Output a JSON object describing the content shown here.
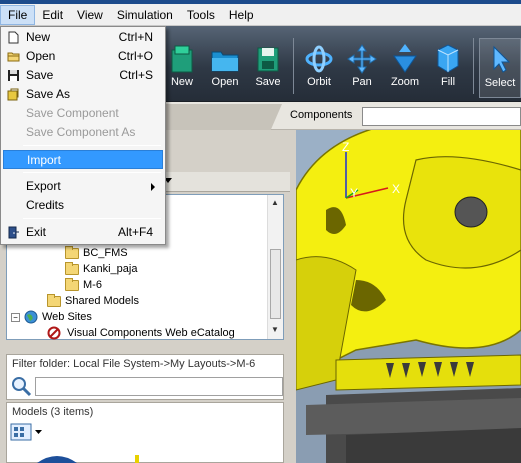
{
  "menubar": {
    "items": [
      "File",
      "Edit",
      "View",
      "Simulation",
      "Tools",
      "Help"
    ]
  },
  "toolbar": {
    "buttons": [
      {
        "label": "New",
        "icon": "new-layout-icon"
      },
      {
        "label": "Open",
        "icon": "open-folder-icon"
      },
      {
        "label": "Save",
        "icon": "save-disk-icon"
      },
      {
        "label": "Orbit",
        "icon": "orbit-icon"
      },
      {
        "label": "Pan",
        "icon": "pan-icon"
      },
      {
        "label": "Zoom",
        "icon": "zoom-icon"
      },
      {
        "label": "Fill",
        "icon": "fill-icon"
      },
      {
        "label": "Select",
        "icon": "select-cursor-icon"
      }
    ]
  },
  "components": {
    "label": "Components",
    "input_value": ""
  },
  "file_menu": {
    "items": [
      {
        "label": "New",
        "shortcut": "Ctrl+N",
        "icon": "new-file-icon",
        "enabled": true
      },
      {
        "label": "Open",
        "shortcut": "Ctrl+O",
        "icon": "open-folder-icon",
        "enabled": true
      },
      {
        "label": "Save",
        "shortcut": "Ctrl+S",
        "icon": "floppy-disk-icon",
        "enabled": true
      },
      {
        "label": "Save As",
        "shortcut": "",
        "icon": "save-as-icon",
        "enabled": true
      },
      {
        "label": "Save Component",
        "shortcut": "",
        "icon": "",
        "enabled": false
      },
      {
        "label": "Save Component As",
        "shortcut": "",
        "icon": "",
        "enabled": false
      },
      {
        "label": "Import",
        "shortcut": "",
        "icon": "",
        "enabled": true,
        "highlighted": true
      },
      {
        "label": "Export",
        "shortcut": "",
        "icon": "",
        "enabled": true,
        "submenu": true
      },
      {
        "label": "Credits",
        "shortcut": "",
        "icon": "",
        "enabled": true
      },
      {
        "label": "Exit",
        "shortcut": "Alt+F4",
        "icon": "exit-door-icon",
        "enabled": true
      }
    ]
  },
  "tree": {
    "items": [
      {
        "label": "BC_FMS",
        "type": "folder"
      },
      {
        "label": "Kanki_paja",
        "type": "folder"
      },
      {
        "label": "M-6",
        "type": "folder"
      },
      {
        "label": "Shared Models",
        "type": "folder"
      },
      {
        "label": "Web Sites",
        "type": "globe"
      },
      {
        "label": "Visual Components Web eCatalog",
        "type": "blocked"
      }
    ]
  },
  "filter": {
    "label": "Filter folder: Local File System->My Layouts->M-6",
    "input_value": ""
  },
  "models": {
    "label": "Models (3 items)"
  },
  "viewport": {
    "axis_labels": {
      "z": "Z",
      "y": "Y",
      "x": "X"
    }
  }
}
